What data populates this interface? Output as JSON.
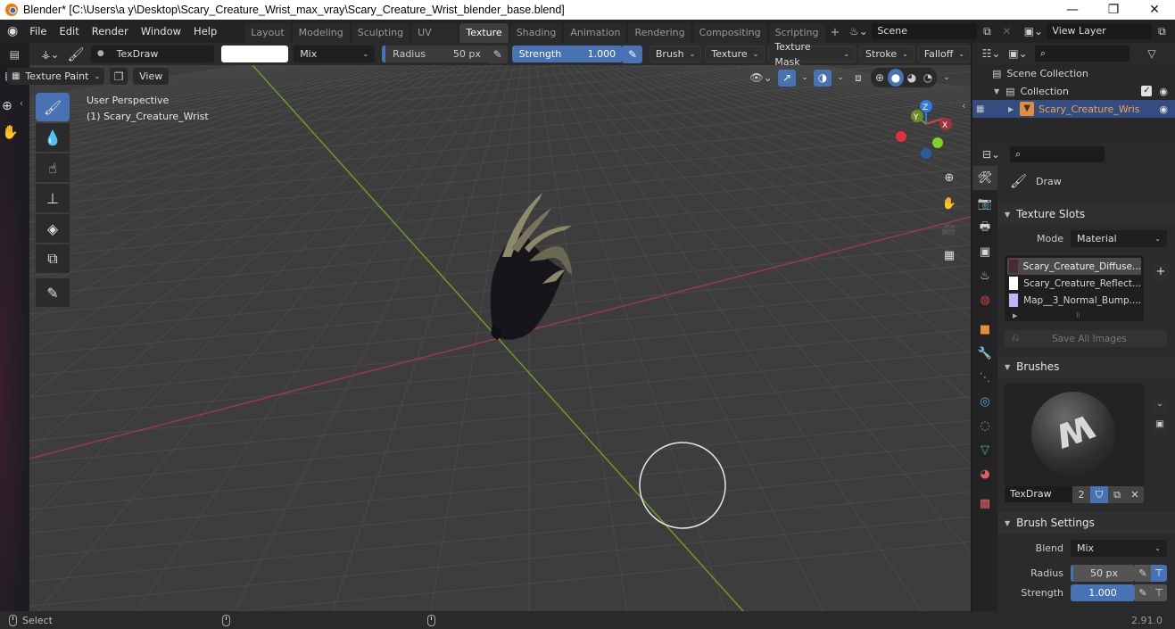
{
  "window": {
    "title": "Blender* [C:\\Users\\a y\\Desktop\\Scary_Creature_Wrist_max_vray\\Scary_Creature_Wrist_blender_base.blend]",
    "controls": [
      "—",
      "❐",
      "✕"
    ]
  },
  "menu": [
    "File",
    "Edit",
    "Render",
    "Window",
    "Help"
  ],
  "workspaces": {
    "tabs": [
      "Layout",
      "Modeling",
      "Sculpting",
      "UV Editing",
      "Texture Paint",
      "Shading",
      "Animation",
      "Rendering",
      "Compositing",
      "Scripting"
    ],
    "active": "Texture Paint",
    "add": "+"
  },
  "scene": {
    "name": "Scene",
    "view_layer": "View Layer"
  },
  "tool_header": {
    "brush_name": "TexDraw",
    "color_hex": "#ffffff",
    "blend": "Mix",
    "radius_label": "Radius",
    "radius_value": "50 px",
    "radius_fraction": 0.05,
    "strength_label": "Strength",
    "strength_value": "1.000",
    "strength_fraction": 1.0,
    "menus": [
      "Brush",
      "Texture",
      "Texture Mask",
      "Stroke",
      "Falloff"
    ]
  },
  "viewport_header": {
    "mode": "Texture Paint",
    "view_menu": "View"
  },
  "viewport": {
    "view_name": "User Perspective",
    "object_label": "(1) Scary_Creature_Wrist",
    "gizmo_axes": {
      "x": "X",
      "y": "Y",
      "z": "Z"
    },
    "colors": {
      "x_axis": "#9b3b45",
      "y_axis": "#6f9a25",
      "z_axis": "#2f7be0",
      "grid_bg": "#3d3d3d"
    }
  },
  "tools": [
    "draw",
    "soften",
    "smear",
    "clone",
    "fill",
    "mask",
    "annotate"
  ],
  "outliner": {
    "scene_collection": "Scene Collection",
    "collection": "Collection",
    "object": "Scary_Creature_Wris"
  },
  "properties": {
    "tool_name": "Draw",
    "texture_slots": {
      "title": "Texture Slots",
      "mode_label": "Mode",
      "mode_value": "Material",
      "slots": [
        {
          "name": "Scary_Creature_Diffuse...",
          "swatch": "#4a2a2e",
          "selected": true
        },
        {
          "name": "Scary_Creature_Reflect...",
          "swatch": "#ffffff",
          "selected": false
        },
        {
          "name": "Map__3_Normal_Bump....",
          "swatch": "#b9b6f5",
          "selected": false
        }
      ],
      "save_all": "Save All Images"
    },
    "brushes": {
      "title": "Brushes",
      "brush_name": "TexDraw",
      "users": "2"
    },
    "brush_settings": {
      "title": "Brush Settings",
      "blend_label": "Blend",
      "blend_value": "Mix",
      "radius_label": "Radius",
      "radius_value": "50 px",
      "strength_label": "Strength",
      "strength_value": "1.000"
    }
  },
  "statusbar": {
    "select": "Select",
    "version": "2.91.0"
  },
  "accent": "#4772b3"
}
